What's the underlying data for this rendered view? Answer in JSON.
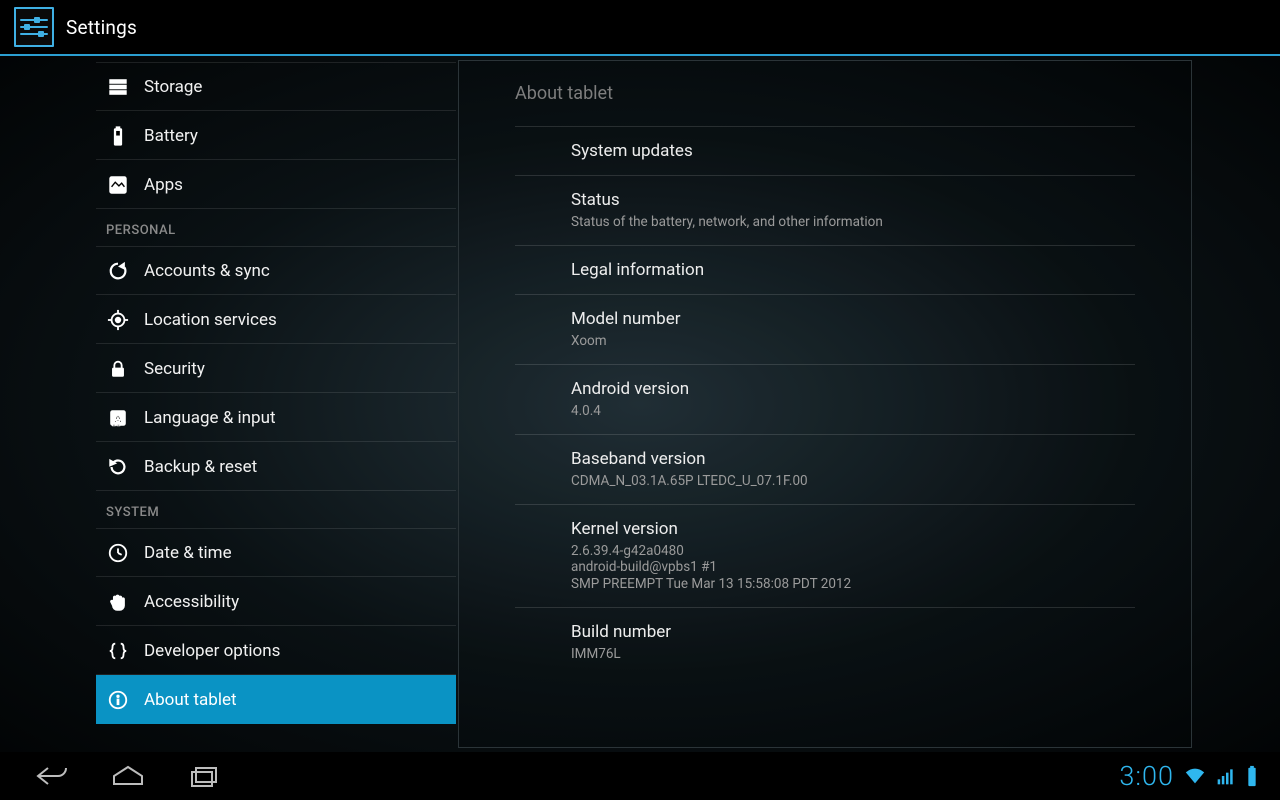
{
  "header": {
    "title": "Settings"
  },
  "sidebar": {
    "items": [
      {
        "label": "Storage",
        "icon": "storage-icon"
      },
      {
        "label": "Battery",
        "icon": "battery-icon"
      },
      {
        "label": "Apps",
        "icon": "apps-icon"
      }
    ],
    "section_personal": "PERSONAL",
    "personal_items": [
      {
        "label": "Accounts & sync",
        "icon": "sync-icon"
      },
      {
        "label": "Location services",
        "icon": "location-icon"
      },
      {
        "label": "Security",
        "icon": "lock-icon"
      },
      {
        "label": "Language & input",
        "icon": "language-icon"
      },
      {
        "label": "Backup & reset",
        "icon": "backup-icon"
      }
    ],
    "section_system": "SYSTEM",
    "system_items": [
      {
        "label": "Date & time",
        "icon": "clock-icon"
      },
      {
        "label": "Accessibility",
        "icon": "hand-icon"
      },
      {
        "label": "Developer options",
        "icon": "braces-icon"
      },
      {
        "label": "About tablet",
        "icon": "info-icon",
        "selected": true
      }
    ]
  },
  "panel": {
    "header": "About tablet",
    "prefs": [
      {
        "title": "System updates",
        "sub": "",
        "interactable": true
      },
      {
        "title": "Status",
        "sub": "Status of the battery, network, and other information",
        "interactable": true
      },
      {
        "title": "Legal information",
        "sub": "",
        "interactable": true
      },
      {
        "title": "Model number",
        "sub": "Xoom",
        "interactable": false
      },
      {
        "title": "Android version",
        "sub": "4.0.4",
        "interactable": false
      },
      {
        "title": "Baseband version",
        "sub": "CDMA_N_03.1A.65P LTEDC_U_07.1F.00",
        "interactable": false
      },
      {
        "title": "Kernel version",
        "sub": "2.6.39.4-g42a0480\nandroid-build@vpbs1 #1\nSMP PREEMPT Tue Mar 13 15:58:08 PDT 2012",
        "interactable": false
      },
      {
        "title": "Build number",
        "sub": "IMM76L",
        "interactable": false
      }
    ]
  },
  "sysbar": {
    "time": "3:00"
  }
}
